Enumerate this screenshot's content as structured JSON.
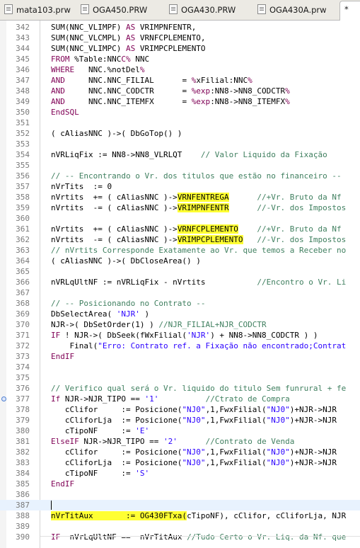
{
  "tabs": [
    {
      "label": "mata103.prw",
      "active": false
    },
    {
      "label": "OGA450.PRW",
      "active": false
    },
    {
      "label": "OGA430.PRW",
      "active": false
    },
    {
      "label": "OGA430A.prw",
      "active": false
    },
    {
      "label": "*",
      "active": true
    }
  ],
  "colors": {
    "keyword": "#7f0055",
    "comment": "#3f7f5f",
    "string": "#2a00ff",
    "highlight": "#ffff33",
    "current_line": "#e8f2fe"
  },
  "lines": [
    {
      "num": "342",
      "segs": [
        [
          "",
          "SUM(NNC_VLIMPF) "
        ],
        [
          "kw",
          "AS"
        ],
        [
          "",
          " VRIMPNFENTR,"
        ]
      ]
    },
    {
      "num": "343",
      "segs": [
        [
          "",
          "SUM(NNC_VLCMPL) "
        ],
        [
          "kw",
          "AS"
        ],
        [
          "",
          " VRNFCPLEMENTO,"
        ]
      ]
    },
    {
      "num": "344",
      "segs": [
        [
          "",
          "SUM(NNC_VLIMPC) "
        ],
        [
          "kw",
          "AS"
        ],
        [
          "",
          " VRIMPCPLEMENTO"
        ]
      ]
    },
    {
      "num": "345",
      "segs": [
        [
          "kw",
          "FROM"
        ],
        [
          "",
          " %Table:NNC"
        ],
        [
          "kw",
          "C%"
        ],
        [
          "",
          " NNC"
        ]
      ]
    },
    {
      "num": "346",
      "segs": [
        [
          "kw",
          "WHERE"
        ],
        [
          "",
          "   NNC.%notDel"
        ],
        [
          "kw",
          "%"
        ]
      ]
    },
    {
      "num": "347",
      "segs": [
        [
          "kw",
          "AND"
        ],
        [
          "",
          "     NNC.NNC_FILIAL      = "
        ],
        [
          "kw",
          "%"
        ],
        [
          "",
          "xFilial:NNC"
        ],
        [
          "kw",
          "%"
        ]
      ]
    },
    {
      "num": "348",
      "segs": [
        [
          "kw",
          "AND"
        ],
        [
          "",
          "     NNC.NNC_CODCTR      = "
        ],
        [
          "kw",
          "%exp"
        ],
        [
          "",
          ":NN8->NN8_CODCTR"
        ],
        [
          "kw",
          "%"
        ]
      ]
    },
    {
      "num": "349",
      "segs": [
        [
          "kw",
          "AND"
        ],
        [
          "",
          "     NNC.NNC_ITEMFX      = "
        ],
        [
          "kw",
          "%exp"
        ],
        [
          "",
          ":NN8->NN8_ITEMFX"
        ],
        [
          "kw",
          "%"
        ]
      ]
    },
    {
      "num": "350",
      "segs": [
        [
          "kw",
          "EndSQL"
        ]
      ]
    },
    {
      "num": "351",
      "segs": []
    },
    {
      "num": "352",
      "segs": [
        [
          "",
          "( cAliasNNC )->( DbGoTop() )"
        ]
      ]
    },
    {
      "num": "353",
      "segs": []
    },
    {
      "num": "354",
      "segs": [
        [
          "",
          "nVRLiqFix := NN8->NN8_VLRLQT    "
        ],
        [
          "cm",
          "// Valor Liquido da Fixação"
        ]
      ]
    },
    {
      "num": "355",
      "segs": []
    },
    {
      "num": "356",
      "segs": [
        [
          "cm",
          "// -- Encontrando o Vr. dos titulos que estão no financeiro --"
        ]
      ]
    },
    {
      "num": "357",
      "segs": [
        [
          "",
          "nVrTits  := 0"
        ]
      ]
    },
    {
      "num": "358",
      "segs": [
        [
          "",
          "nVrtits  += ( cAliasNNC )->"
        ],
        [
          "hl",
          "VRNFENTREGA"
        ],
        [
          "",
          "      "
        ],
        [
          "cm",
          "//+Vr. Bruto da Nf"
        ]
      ]
    },
    {
      "num": "359",
      "segs": [
        [
          "",
          "nVrtits  -= ( cAliasNNC )->"
        ],
        [
          "hl",
          "VRIMPNFENTR"
        ],
        [
          "",
          "      "
        ],
        [
          "cm",
          "//-Vr. dos Impostos"
        ]
      ]
    },
    {
      "num": "360",
      "segs": []
    },
    {
      "num": "361",
      "segs": [
        [
          "",
          "nVrtits  += ( cAliasNNC )->"
        ],
        [
          "hl",
          "VRNFCPLEMENTO"
        ],
        [
          "",
          "    "
        ],
        [
          "cm",
          "//+Vr. Bruto da Nf"
        ]
      ]
    },
    {
      "num": "362",
      "segs": [
        [
          "",
          "nVrtits  -= ( cAliasNNC )->"
        ],
        [
          "hl",
          "VRIMPCPLEMENTO"
        ],
        [
          "",
          "   "
        ],
        [
          "cm",
          "//-Vr. dos Impostos"
        ]
      ]
    },
    {
      "num": "363",
      "segs": [
        [
          "cm",
          "// nVrtits Corresponde Exatamente ao Vr. que temos a Receber no"
        ]
      ]
    },
    {
      "num": "364",
      "segs": [
        [
          "",
          "( cAliasNNC )->( DbCloseArea() )"
        ]
      ]
    },
    {
      "num": "365",
      "segs": []
    },
    {
      "num": "366",
      "segs": [
        [
          "",
          "nVRLqUltNF := nVRLiqFix - nVrtits           "
        ],
        [
          "cm",
          "//Encontro o Vr. Li"
        ]
      ]
    },
    {
      "num": "367",
      "segs": []
    },
    {
      "num": "368",
      "segs": [
        [
          "cm",
          "// -- Posicionando no Contrato --"
        ]
      ]
    },
    {
      "num": "369",
      "segs": [
        [
          "",
          "DbSelectArea( "
        ],
        [
          "st",
          "'NJR'"
        ],
        [
          "",
          " )"
        ]
      ]
    },
    {
      "num": "370",
      "segs": [
        [
          "",
          "NJR->( DbSetOrder(1) ) "
        ],
        [
          "cm",
          "//NJR_FILIAL+NJR_CODCTR"
        ]
      ]
    },
    {
      "num": "371",
      "segs": [
        [
          "kw",
          "IF"
        ],
        [
          "",
          " ! NJR->( DbSeek(fWxFilial("
        ],
        [
          "st",
          "'NJR'"
        ],
        [
          "",
          ") + NN8->NN8_CODCTR ) )"
        ]
      ]
    },
    {
      "num": "372",
      "segs": [
        [
          "",
          "    Final("
        ],
        [
          "st",
          "\"Erro: Contrato ref. a Fixação não encontrado;Contrat"
        ]
      ]
    },
    {
      "num": "373",
      "segs": [
        [
          "kw",
          "EndIF"
        ]
      ]
    },
    {
      "num": "374",
      "segs": []
    },
    {
      "num": "375",
      "segs": []
    },
    {
      "num": "376",
      "segs": [
        [
          "cm",
          "// Verifico qual será o Vr. liquido do titulo Sem funrural + fe"
        ]
      ]
    },
    {
      "num": "377",
      "segs": [
        [
          "kw",
          "If"
        ],
        [
          "",
          " NJR->NJR_TIPO == "
        ],
        [
          "st",
          "'1'"
        ],
        [
          "",
          "          "
        ],
        [
          "cm",
          "//Ctrato de Compra"
        ]
      ]
    },
    {
      "num": "378",
      "segs": [
        [
          "",
          "   cClifor     := Posicione("
        ],
        [
          "st",
          "\"NJ0\""
        ],
        [
          "",
          ",1,FwxFilial("
        ],
        [
          "st",
          "\"NJ0\""
        ],
        [
          "",
          ")+NJR->NJR"
        ]
      ]
    },
    {
      "num": "379",
      "segs": [
        [
          "",
          "   cCliforLja  := Posicione("
        ],
        [
          "st",
          "\"NJ0\""
        ],
        [
          "",
          ",1,FwxFilial("
        ],
        [
          "st",
          "\"NJ0\""
        ],
        [
          "",
          ")+NJR->NJR"
        ]
      ]
    },
    {
      "num": "380",
      "segs": [
        [
          "",
          "   cTipoNF     := "
        ],
        [
          "st",
          "'E'"
        ]
      ]
    },
    {
      "num": "381",
      "segs": [
        [
          "kw",
          "ElseIF"
        ],
        [
          "",
          " NJR->NJR_TIPO == "
        ],
        [
          "st",
          "'2'"
        ],
        [
          "",
          "      "
        ],
        [
          "cm",
          "//Contrato de Venda"
        ]
      ]
    },
    {
      "num": "382",
      "segs": [
        [
          "",
          "   cClifor     := Posicione("
        ],
        [
          "st",
          "\"NJ0\""
        ],
        [
          "",
          ",1,FwxFilial("
        ],
        [
          "st",
          "\"NJ0\""
        ],
        [
          "",
          ")+NJR->NJR"
        ]
      ]
    },
    {
      "num": "383",
      "segs": [
        [
          "",
          "   cCliforLja  := Posicione("
        ],
        [
          "st",
          "\"NJ0\""
        ],
        [
          "",
          ",1,FwxFilial("
        ],
        [
          "st",
          "\"NJ0\""
        ],
        [
          "",
          ")+NJR->NJR"
        ]
      ]
    },
    {
      "num": "384",
      "segs": [
        [
          "",
          "   cTipoNF     := "
        ],
        [
          "st",
          "'S'"
        ]
      ]
    },
    {
      "num": "385",
      "segs": [
        [
          "kw",
          "EndIF"
        ]
      ]
    },
    {
      "num": "386",
      "segs": []
    },
    {
      "num": "387",
      "segs": [],
      "current": true
    },
    {
      "num": "388",
      "segs": [
        [
          "hl",
          "nVrTitAux       := OG430FTxa("
        ],
        [
          "",
          "cTipoNF), cClifor, cCliforLja, NJR"
        ]
      ]
    },
    {
      "num": "389",
      "segs": []
    },
    {
      "num": "390",
      "segs": [
        [
          "kw",
          "IF"
        ],
        [
          "",
          "  nVrLqUltNF ==  nVrTitAux "
        ],
        [
          "cm",
          "//Tudo Certo o Vr. Liq. da Nf. que"
        ]
      ]
    }
  ]
}
